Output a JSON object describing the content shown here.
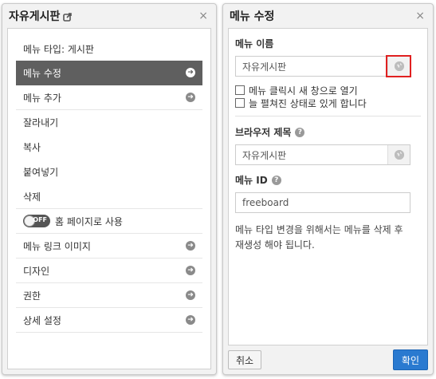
{
  "left_panel": {
    "title": "자유게시판",
    "close": "×",
    "menu_type_label": "메뉴 타입: 게시판",
    "items": [
      {
        "label": "메뉴 수정",
        "arrow": "➜",
        "active": true
      },
      {
        "label": "메뉴 추가",
        "arrow": "➜"
      },
      {
        "label": "잘라내기"
      },
      {
        "label": "복사"
      },
      {
        "label": "붙여넣기"
      },
      {
        "label": "삭제"
      }
    ],
    "toggle": {
      "state": "OFF",
      "label": "홈 페이지로 사용"
    },
    "items2": [
      {
        "label": "메뉴 링크 이미지",
        "arrow": "➜"
      },
      {
        "label": "디자인",
        "arrow": "➜"
      },
      {
        "label": "권한",
        "arrow": "➜"
      },
      {
        "label": "상세 설정",
        "arrow": "➜"
      }
    ]
  },
  "right_panel": {
    "title": "메뉴 수정",
    "close": "×",
    "menu_name_label": "메뉴 이름",
    "menu_name_value": "자유게시판",
    "checkbox_new_window": "메뉴 클릭시 새 창으로 열기",
    "checkbox_expanded": "늘 펼쳐진 상태로 있게 합니다",
    "browser_title_label": "브라우저 제목",
    "browser_title_value": "자유게시판",
    "menu_id_label": "메뉴 ID",
    "menu_id_value": "freeboard",
    "help_text": "메뉴 타입 변경을 위해서는 메뉴를 삭제 후 재생성 해야 됩니다.",
    "help_icon": "?",
    "cancel_label": "취소",
    "ok_label": "확인"
  },
  "colors": {
    "active_menu_bg": "#5f5f5f",
    "ok_button": "#2a7ad0",
    "highlight": "#e02020"
  }
}
